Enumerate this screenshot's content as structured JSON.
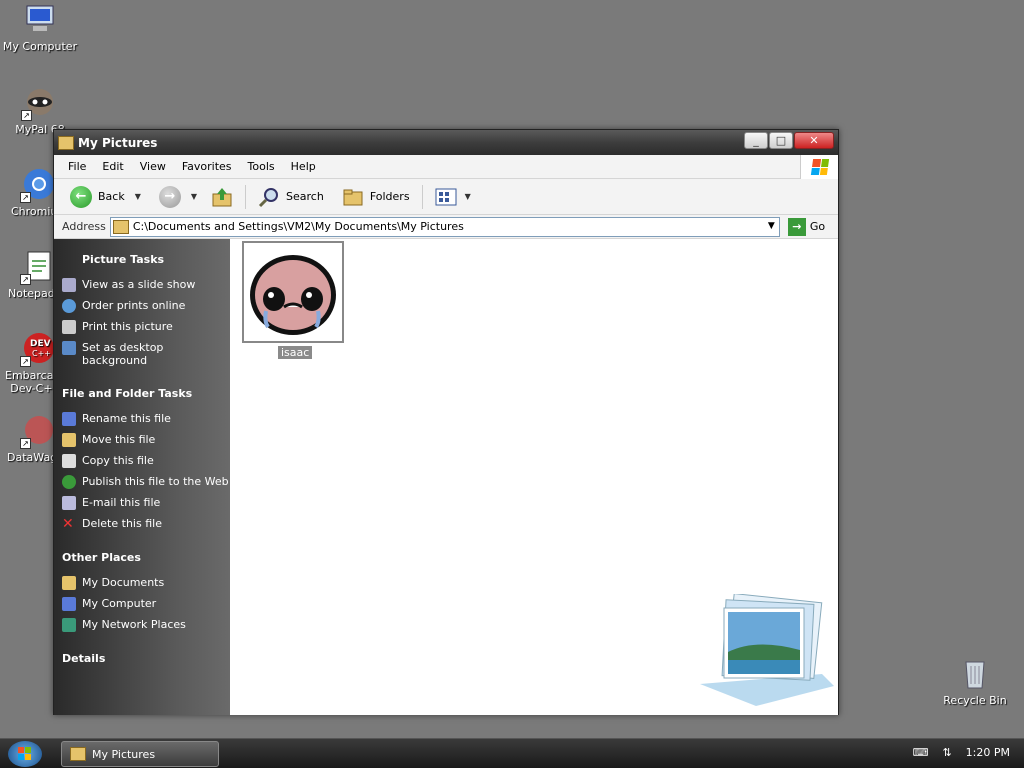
{
  "desktop": {
    "icons": [
      {
        "label": "My Computer"
      },
      {
        "label": "MyPal 68"
      },
      {
        "label": "Chromium"
      },
      {
        "label": "Notepad++"
      },
      {
        "label": "Embarcadero Dev-C++"
      },
      {
        "label": "DataWagon"
      },
      {
        "label": "Recycle Bin"
      }
    ]
  },
  "window": {
    "title": "My Pictures",
    "buttons": {
      "minimize": "_",
      "maximize": "□",
      "close": "✕"
    }
  },
  "menu": [
    "File",
    "Edit",
    "View",
    "Favorites",
    "Tools",
    "Help"
  ],
  "toolbar": {
    "back": "Back",
    "search": "Search",
    "folders": "Folders"
  },
  "address": {
    "label": "Address",
    "path": "C:\\Documents and Settings\\VM2\\My Documents\\My Pictures",
    "go": "Go"
  },
  "tasks": {
    "picture_tasks": {
      "title": "Picture Tasks",
      "items": [
        "View as a slide show",
        "Order prints online",
        "Print this picture",
        "Set as desktop background"
      ]
    },
    "file_folder_tasks": {
      "title": "File and Folder Tasks",
      "items": [
        "Rename this file",
        "Move this file",
        "Copy this file",
        "Publish this file to the Web",
        "E-mail this file",
        "Delete this file"
      ]
    },
    "other_places": {
      "title": "Other Places",
      "items": [
        "My Documents",
        "My Computer",
        "My Network Places"
      ]
    },
    "details": {
      "title": "Details"
    }
  },
  "files": [
    {
      "name": "isaac"
    }
  ],
  "taskbar": {
    "task_label": "My Pictures",
    "time": "1:20 PM"
  },
  "colors": {
    "desktop": "#7a7a7a",
    "accent_green": "#2a9a2a"
  }
}
